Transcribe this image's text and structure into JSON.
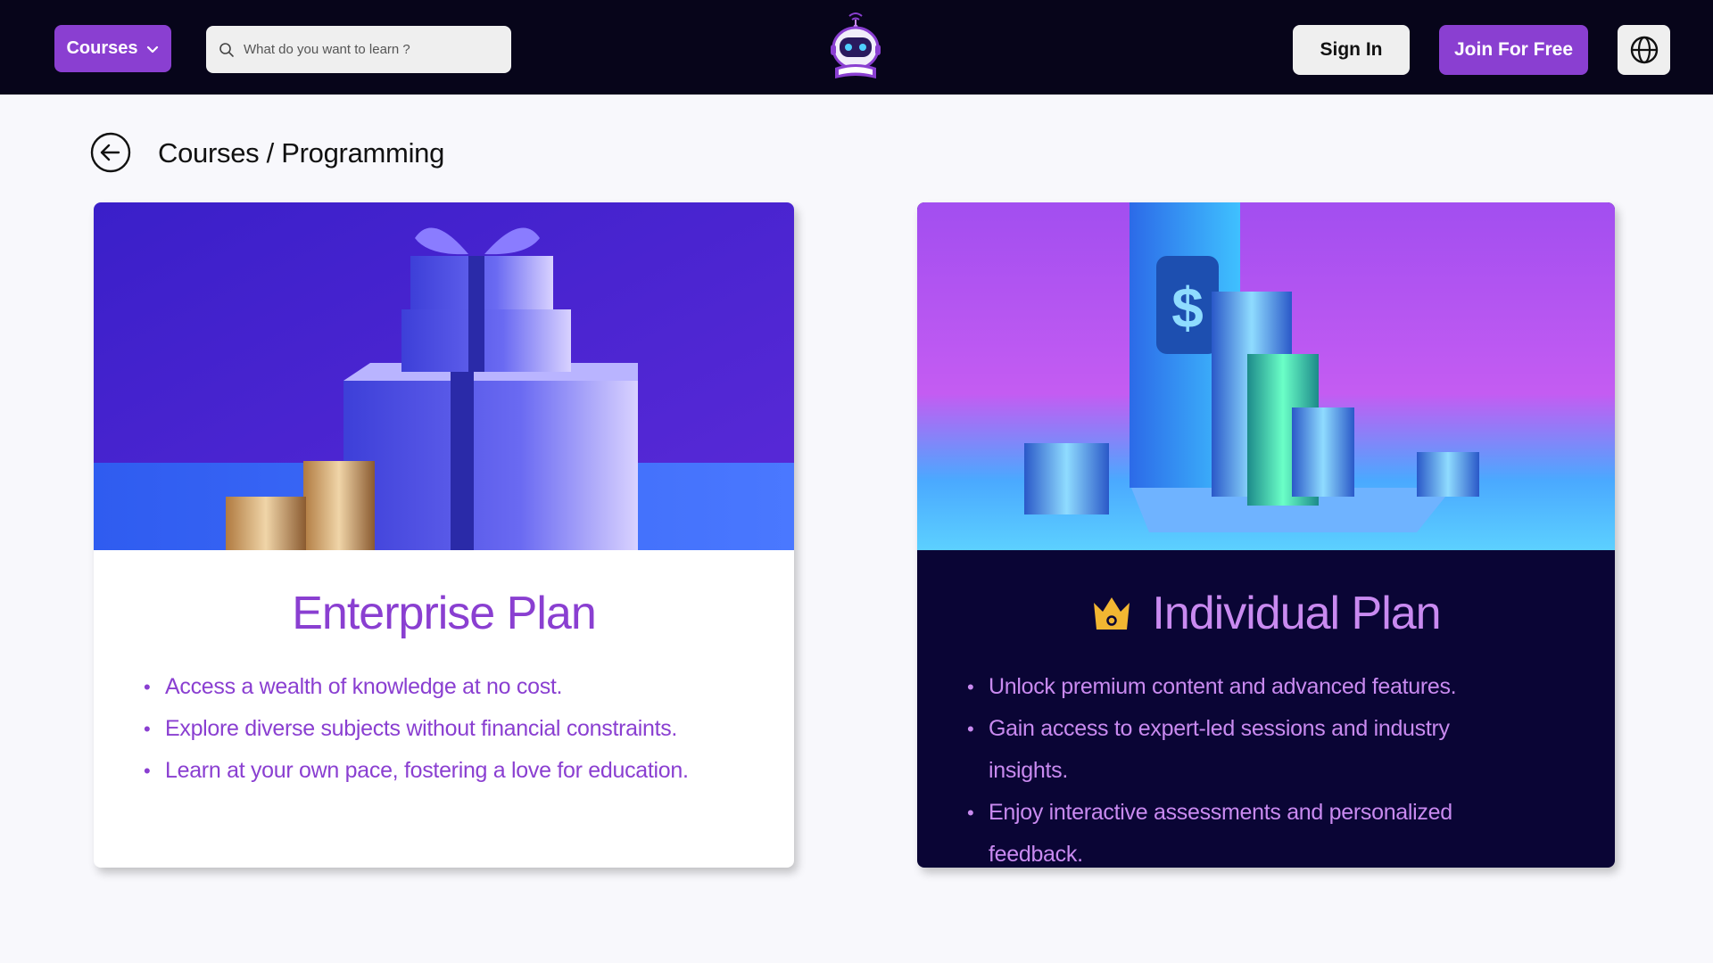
{
  "header": {
    "courses_label": "Courses",
    "search_placeholder": "What do you want to learn ?",
    "signin_label": "Sign In",
    "join_label": "Join For Free",
    "icons": [
      "chevron-down-icon",
      "search-icon",
      "robot-logo-icon",
      "globe-icon"
    ]
  },
  "breadcrumb": {
    "text": "Courses / Programming",
    "back_icon": "arrow-left-circle-icon"
  },
  "colors": {
    "accent": "#8a3fd1",
    "accent_light": "#c98af0",
    "header_bg": "#07051a",
    "dark_card_bg": "#0a0535",
    "crown": "#f2b632"
  },
  "plans": {
    "enterprise": {
      "title": "Enterprise Plan",
      "features": [
        "Access a wealth of knowledge at no cost.",
        "Explore diverse subjects without financial constraints.",
        "Learn at your own pace, fostering a love for education."
      ]
    },
    "individual": {
      "title": "Individual Plan",
      "icon": "crown-icon",
      "features": [
        "Unlock premium content and advanced features.",
        "Gain access to expert-led sessions and industry insights.",
        "Enjoy interactive assessments and personalized feedback."
      ]
    }
  }
}
